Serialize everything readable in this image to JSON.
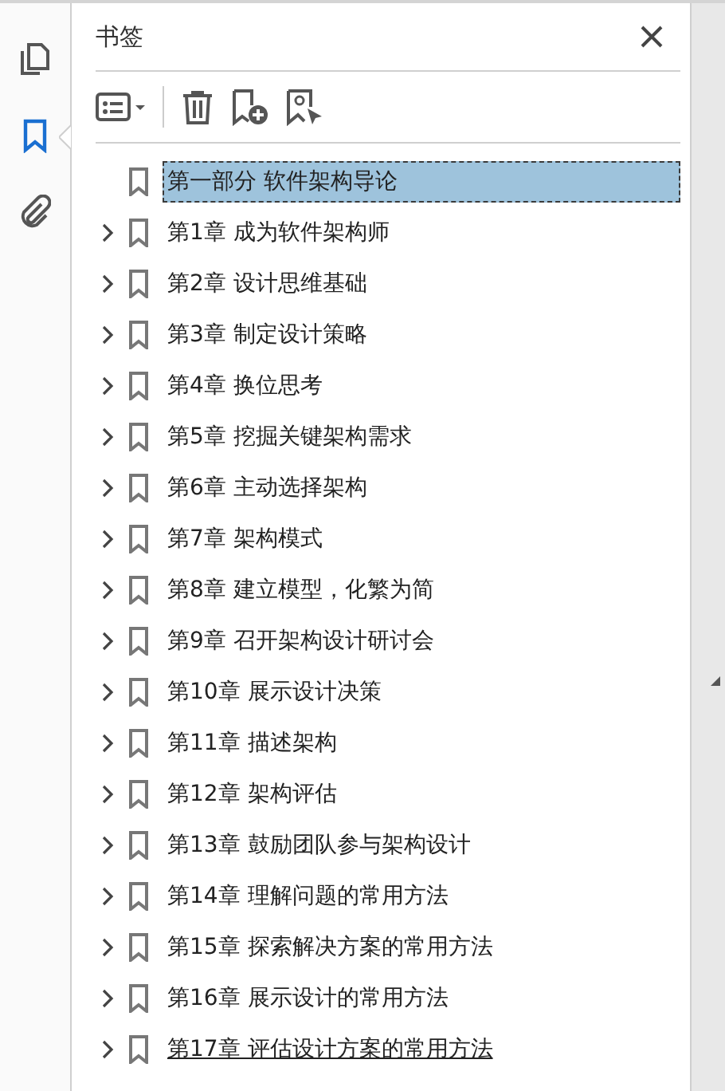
{
  "sidebar": {
    "items": [
      {
        "selected": false
      },
      {
        "selected": true
      },
      {
        "selected": false
      }
    ]
  },
  "panel": {
    "title": "书签"
  },
  "bookmarks": [
    {
      "label": "第一部分  软件架构导论",
      "expandable": false,
      "selected": true,
      "hovered": false
    },
    {
      "label": "第1章  成为软件架构师",
      "expandable": true,
      "selected": false,
      "hovered": false
    },
    {
      "label": "第2章  设计思维基础",
      "expandable": true,
      "selected": false,
      "hovered": false
    },
    {
      "label": "第3章  制定设计策略",
      "expandable": true,
      "selected": false,
      "hovered": false
    },
    {
      "label": "第4章  换位思考",
      "expandable": true,
      "selected": false,
      "hovered": false
    },
    {
      "label": "第5章  挖掘关键架构需求",
      "expandable": true,
      "selected": false,
      "hovered": false
    },
    {
      "label": "第6章  主动选择架构",
      "expandable": true,
      "selected": false,
      "hovered": false
    },
    {
      "label": "第7章  架构模式",
      "expandable": true,
      "selected": false,
      "hovered": false
    },
    {
      "label": "第8章  建立模型，化繁为简",
      "expandable": true,
      "selected": false,
      "hovered": false
    },
    {
      "label": "第9章  召开架构设计研讨会",
      "expandable": true,
      "selected": false,
      "hovered": false
    },
    {
      "label": "第10章  展示设计决策",
      "expandable": true,
      "selected": false,
      "hovered": false
    },
    {
      "label": "第11章  描述架构",
      "expandable": true,
      "selected": false,
      "hovered": false
    },
    {
      "label": "第12章  架构评估",
      "expandable": true,
      "selected": false,
      "hovered": false
    },
    {
      "label": "第13章  鼓励团队参与架构设计",
      "expandable": true,
      "selected": false,
      "hovered": false
    },
    {
      "label": "第14章  理解问题的常用方法",
      "expandable": true,
      "selected": false,
      "hovered": false
    },
    {
      "label": "第15章  探索解决方案的常用方法",
      "expandable": true,
      "selected": false,
      "hovered": false
    },
    {
      "label": "第16章  展示设计的常用方法",
      "expandable": true,
      "selected": false,
      "hovered": false
    },
    {
      "label": "第17章  评估设计方案的常用方法",
      "expandable": true,
      "selected": false,
      "hovered": true
    }
  ]
}
